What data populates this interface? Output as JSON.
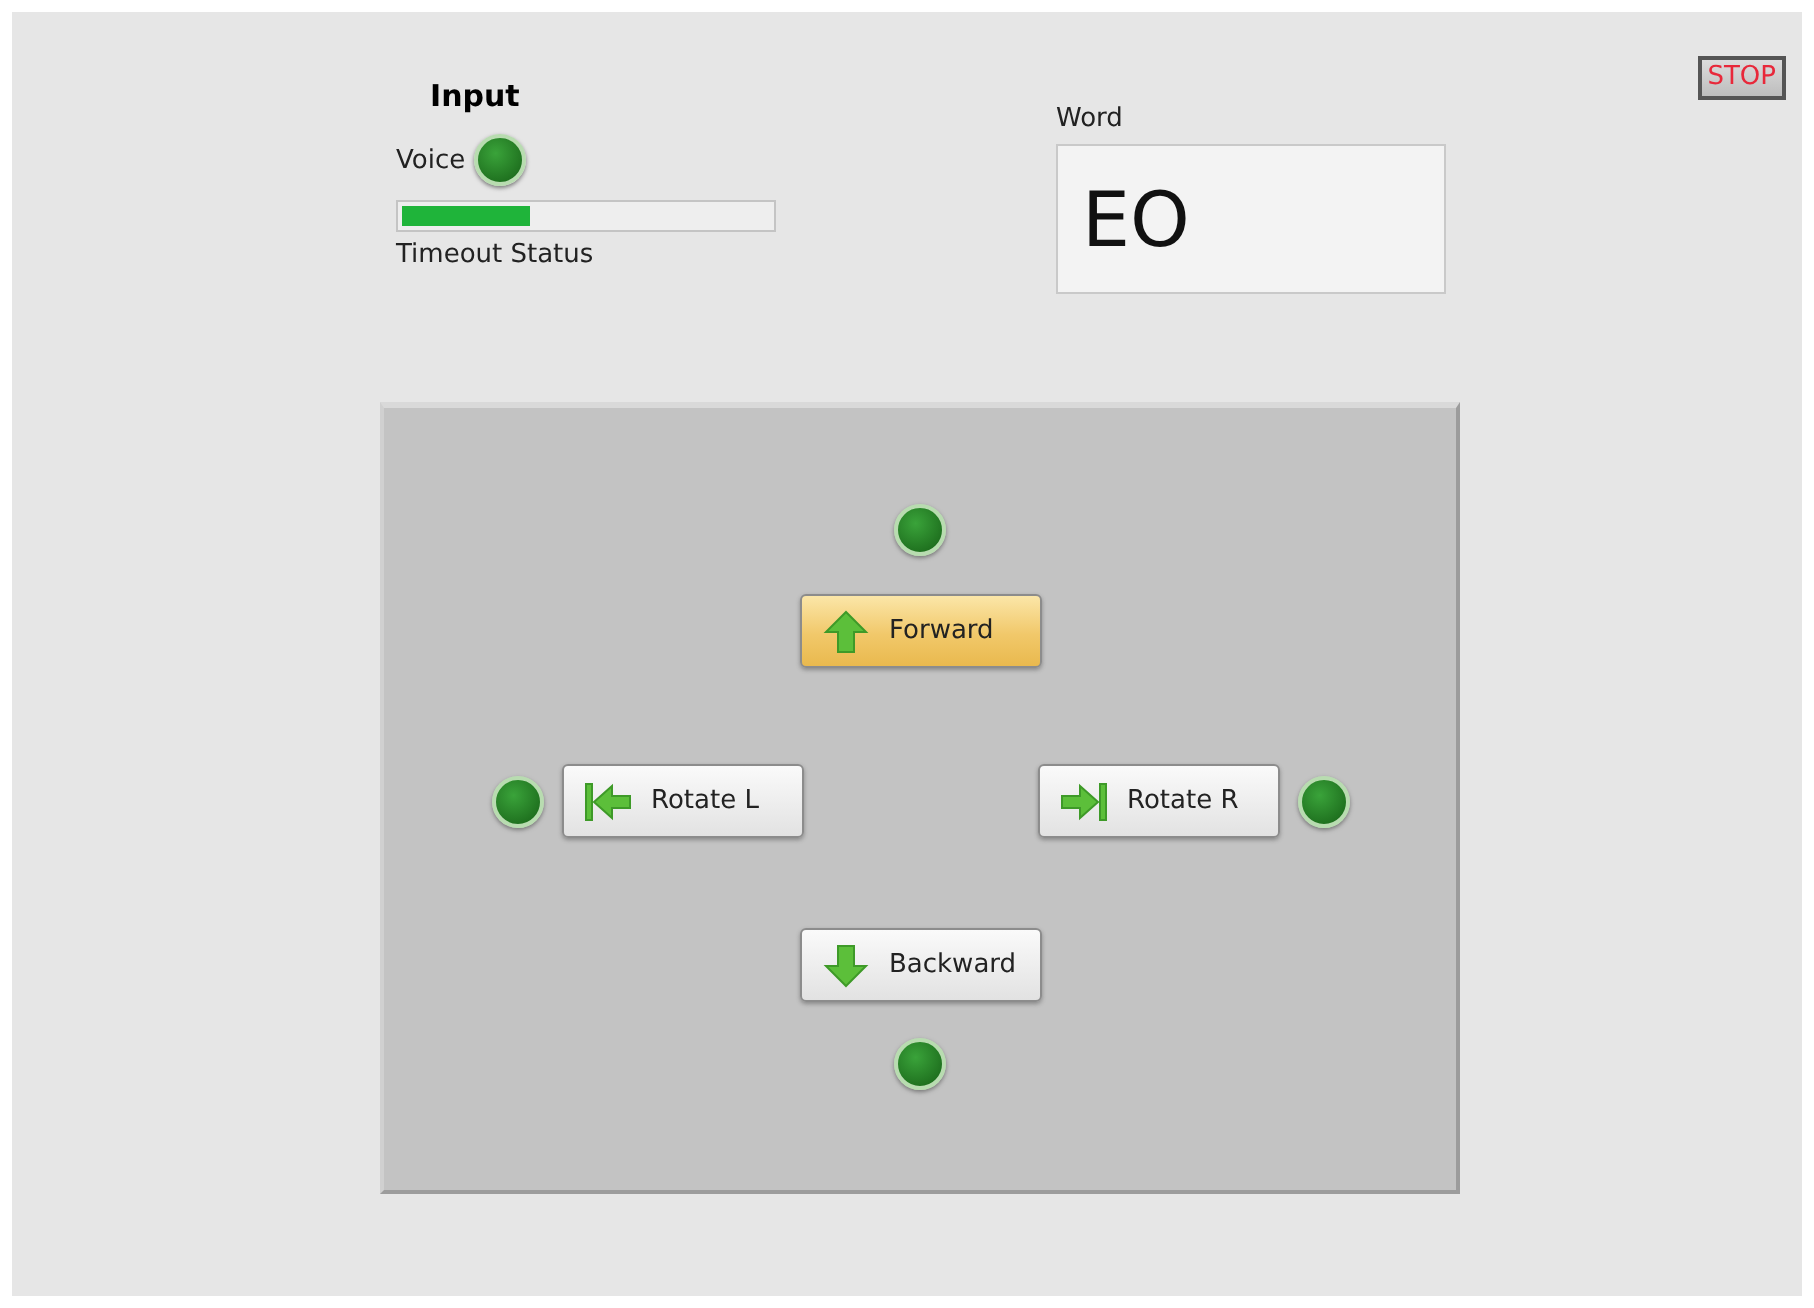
{
  "stop_button": {
    "label": "STOP"
  },
  "input": {
    "title": "Input",
    "voice_label": "Voice",
    "voice_led": {
      "on": false
    },
    "timeout_bar": {
      "level": 0.35
    },
    "timeout_label": "Timeout Status"
  },
  "word": {
    "label": "Word",
    "value": "EO"
  },
  "controls": {
    "forward": {
      "label": "Forward",
      "selected": true,
      "led": {
        "on": false
      }
    },
    "rotate_left": {
      "label": "Rotate L",
      "selected": false,
      "led": {
        "on": false
      }
    },
    "rotate_right": {
      "label": "Rotate R",
      "selected": false,
      "led": {
        "on": false
      }
    },
    "backward": {
      "label": "Backward",
      "selected": false,
      "led": {
        "on": false
      }
    }
  }
}
